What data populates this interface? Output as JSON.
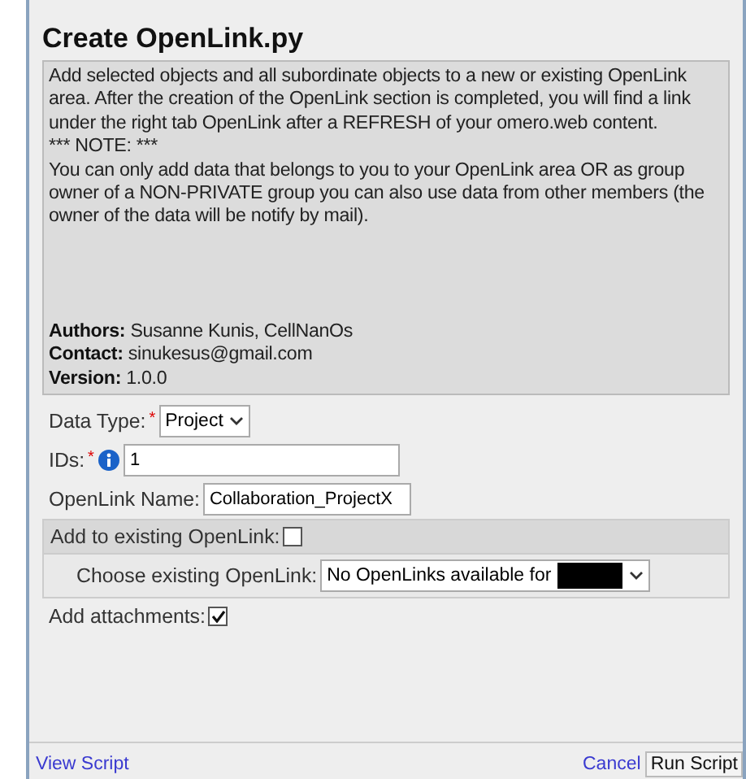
{
  "title": "Create OpenLink.py",
  "description": {
    "paragraphs": [
      "Add selected objects and all subordinate objects to a new or existing OpenLink area. After the creation of the OpenLink section is completed, you will find a link under the right tab OpenLink after a REFRESH of your omero.web content.",
      "*** NOTE: ***",
      "You can only add data that belongs to you to your OpenLink area OR as group owner of a NON-PRIVATE group you can also use data from other members (the owner of the data will be notify by mail)."
    ],
    "meta": [
      {
        "label": "Authors:",
        "value": "Susanne Kunis, CellNanOs"
      },
      {
        "label": "Contact:",
        "value": "sinukesus@gmail.com"
      },
      {
        "label": "Version:",
        "value": "1.0.0"
      }
    ]
  },
  "required_mark": "*",
  "fields": [
    {
      "kind": "select",
      "label": "Data Type:",
      "required": true,
      "info": false,
      "value": "Project"
    },
    {
      "kind": "text",
      "label": "IDs:",
      "required": true,
      "info": true,
      "value": "1"
    },
    {
      "kind": "text",
      "label": "OpenLink Name:",
      "required": false,
      "info": false,
      "value": "Collaboration_ProjectX"
    }
  ],
  "group": {
    "label": "Add to existing OpenLink:",
    "checked": false,
    "child": {
      "label": "Choose existing OpenLink:",
      "value": "No OpenLinks available for",
      "redacted": true
    }
  },
  "attachments": {
    "label": "Add attachments:",
    "checked": true
  },
  "footer": {
    "link": "View Script",
    "cancel": "Cancel",
    "run": "Run Script"
  }
}
